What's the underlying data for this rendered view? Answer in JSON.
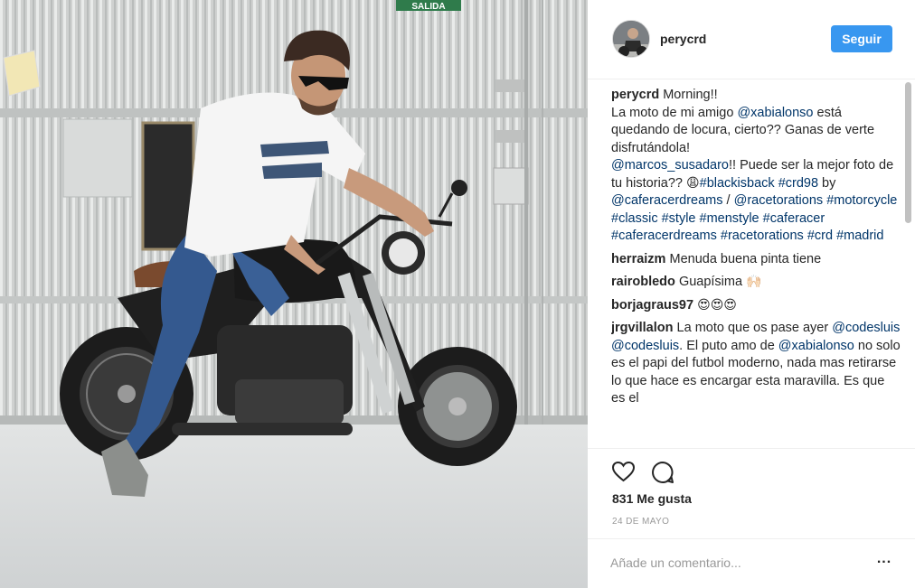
{
  "photo": {
    "sign_text": "SALIDA"
  },
  "header": {
    "username": "perycrd",
    "follow_label": "Seguir"
  },
  "caption": {
    "username": "perycrd",
    "t1": " Morning!!",
    "t2": "La moto de mi amigo ",
    "m1": "@xabialonso",
    "t3": " está quedando de locura, cierto?? Ganas de verte disfrutándola!",
    "m2": "@marcos_susadaro",
    "t4": "!! Puede ser la mejor foto de tu historia?? ",
    "emoji1": "😩",
    "h1": "#blackisback",
    "h2": "#crd98",
    "t5": " by ",
    "m3": "@caferacerdreams",
    "t6": " / ",
    "m4": "@racetorations",
    "h3": "#motorcycle",
    "h4": "#classic",
    "h5": "#style",
    "h6": "#menstyle",
    "h7": "#caferacer",
    "h8": "#caferacerdreams",
    "h9": "#racetorations",
    "h10": "#crd",
    "h11": "#madrid"
  },
  "comments": [
    {
      "username": "herraizm",
      "text": "Menuda buena pinta tiene"
    },
    {
      "username": "rairobledo",
      "text": "Guapísima",
      "emoji": "🙌🏻"
    },
    {
      "username": "borjagraus97",
      "emoji": "😍😍😍"
    },
    {
      "username": "jrgvillalon",
      "t1": "La moto que os pase ayer ",
      "m1": "@codesluis",
      "m2": "@codesluis",
      "t2": ". El puto amo de ",
      "m3": "@xabialonso",
      "t3": " no solo es el papi del futbol moderno, nada mas retirarse lo que hace es encargar esta maravilla. Es que es el"
    }
  ],
  "actions": {
    "like_icon": "heart-icon",
    "comment_icon": "comment-icon",
    "likes_text": "831 Me gusta",
    "date": "24 DE MAYO"
  },
  "comment_box": {
    "placeholder": "Añade un comentario...",
    "more_label": "..."
  },
  "colors": {
    "accent": "#3897f0",
    "link": "#003569",
    "text": "#262626",
    "muted": "#999999"
  }
}
